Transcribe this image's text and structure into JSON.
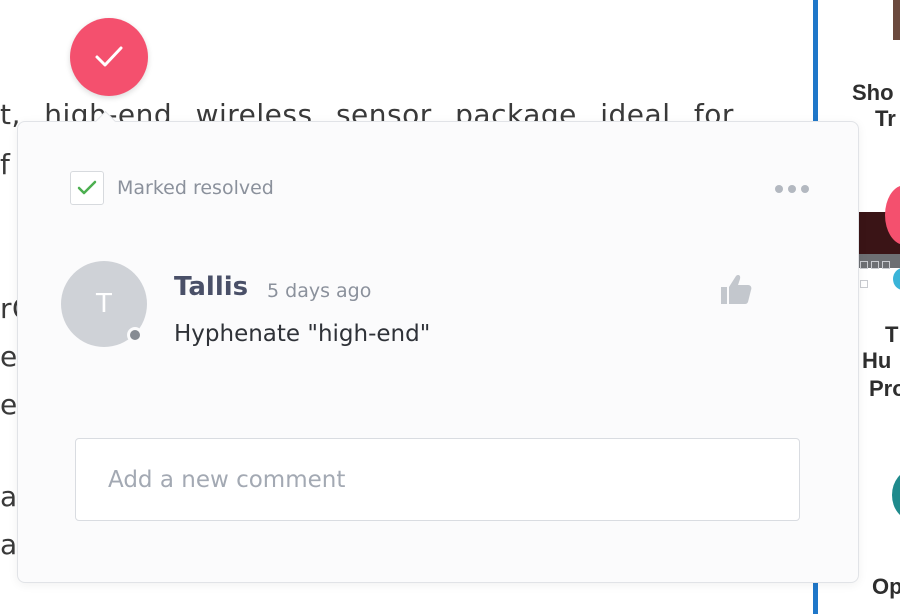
{
  "document": {
    "lines": [
      "t, high-end wireless sensor package ideal for",
      "f",
      "rG",
      "en",
      "e",
      "a",
      "ac"
    ]
  },
  "sidebar": {
    "card_titles": [
      {
        "line1": "Sho",
        "line2": "Tr"
      },
      {
        "line1": "T",
        "line2": "Hu",
        "line3": "Pro"
      },
      {
        "line1": "Op"
      }
    ]
  },
  "comment_popover": {
    "status_label": "Marked resolved",
    "comment": {
      "avatar_initial": "T",
      "author": "Tallis",
      "timestamp": "5 days ago",
      "text": "Hyphenate \"high-end\""
    },
    "new_comment": {
      "value": "",
      "placeholder": "Add a new comment"
    }
  },
  "colors": {
    "resolve_marker": "#f4506e",
    "check_green": "#4caf50",
    "divider_blue": "#1f77c9"
  },
  "icons": {
    "resolve": "check-icon",
    "status": "checkbox-checked-icon",
    "menu": "more-horizontal-icon",
    "like": "thumbs-up-icon"
  }
}
